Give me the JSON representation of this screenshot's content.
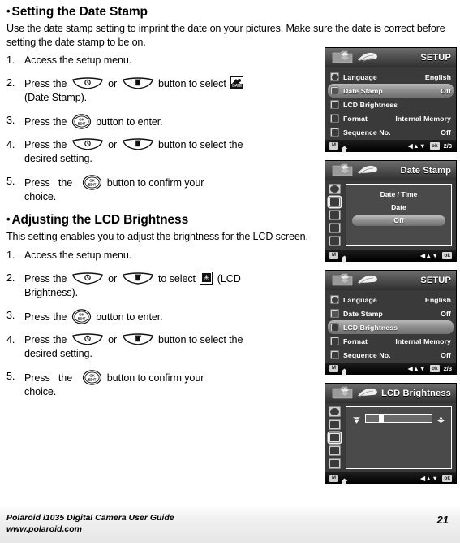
{
  "sections": [
    {
      "bullet": "•",
      "title": "Setting the Date Stamp",
      "intro": "Use the date stamp setting to imprint the date on your pictures. Make sure the date is correct before setting the date stamp to be on.",
      "steps": [
        {
          "num": "1.",
          "pre": "Access the setup menu.",
          "post": "",
          "line2": ""
        },
        {
          "num": "2.",
          "pre": "Press the",
          "mid": "or",
          "mid2": "button to select",
          "post": "",
          "line2": "(Date Stamp)."
        },
        {
          "num": "3.",
          "pre": "Press the",
          "post": "button to enter.",
          "line2": ""
        },
        {
          "num": "4.",
          "pre": "Press the",
          "mid": "or",
          "mid2": "button to select the",
          "post": "",
          "line2": "desired setting."
        },
        {
          "num": "5.",
          "pre": "Press",
          "mid": "the",
          "mid2": "button  to  confirm  your",
          "post": "",
          "line2": "choice."
        }
      ]
    },
    {
      "bullet": "•",
      "title": "Adjusting the LCD Brightness",
      "intro": "This setting enables you to adjust the brightness for the LCD screen.",
      "steps": [
        {
          "num": "1.",
          "pre": "Access the setup menu.",
          "post": "",
          "line2": ""
        },
        {
          "num": "2.",
          "pre": "Press the",
          "mid": "or",
          "mid2": "to select",
          "post": "(LCD",
          "line2": "Brightness)."
        },
        {
          "num": "3.",
          "pre": "Press the",
          "post": "button to enter.",
          "line2": ""
        },
        {
          "num": "4.",
          "pre": "Press the",
          "mid": "or",
          "mid2": "button to select the",
          "post": "",
          "line2": "desired setting."
        },
        {
          "num": "5.",
          "pre": "Press",
          "mid": "the",
          "mid2": "button  to  confirm  your",
          "post": "",
          "line2": "choice."
        }
      ]
    }
  ],
  "icon_labels": {
    "date_stamp_icon": "DATE",
    "lcd_icon_glyph": "✳",
    "ok_button_top": "OK",
    "ok_button_bottom": "EDIT"
  },
  "screens": [
    {
      "id": "setup-menu-date-stamp",
      "title": "SETUP",
      "rows": [
        {
          "label": "Language",
          "value": "English",
          "selected": false,
          "icon": "globe-icon"
        },
        {
          "label": "Date Stamp",
          "value": "Off",
          "selected": true,
          "icon": "date-stamp-icon"
        },
        {
          "label": "LCD Brightness",
          "value": "",
          "selected": false,
          "icon": "lcd-brightness-icon"
        },
        {
          "label": "Format",
          "value": "Internal Memory",
          "selected": false,
          "icon": "format-icon"
        },
        {
          "label": "Sequence No.",
          "value": "Off",
          "selected": false,
          "icon": "sequence-icon"
        }
      ],
      "footer": {
        "mode": "M",
        "arrows": "◀▲▼",
        "ok": "ok",
        "page": "2/3"
      }
    },
    {
      "id": "date-stamp-submenu",
      "title": "Date Stamp",
      "options": [
        {
          "label": "Date / Time",
          "selected": false
        },
        {
          "label": "Date",
          "selected": false
        },
        {
          "label": "Off",
          "selected": true
        }
      ],
      "sidebar_active_index": 1,
      "footer": {
        "mode": "M",
        "arrows": "◀▲▼",
        "ok": "ok",
        "page": ""
      }
    },
    {
      "id": "setup-menu-lcd-brightness",
      "title": "SETUP",
      "rows": [
        {
          "label": "Language",
          "value": "English",
          "selected": false,
          "icon": "globe-icon"
        },
        {
          "label": "Date Stamp",
          "value": "Off",
          "selected": false,
          "icon": "date-stamp-icon"
        },
        {
          "label": "LCD Brightness",
          "value": "",
          "selected": true,
          "icon": "lcd-brightness-icon"
        },
        {
          "label": "Format",
          "value": "Internal Memory",
          "selected": false,
          "icon": "format-icon"
        },
        {
          "label": "Sequence No.",
          "value": "Off",
          "selected": false,
          "icon": "sequence-icon"
        }
      ],
      "footer": {
        "mode": "M",
        "arrows": "◀▲▼",
        "ok": "ok",
        "page": "2/3"
      }
    },
    {
      "id": "lcd-brightness-slider",
      "title": "LCD Brightness",
      "slider": {
        "value_percent": 20
      },
      "sidebar_active_index": 2,
      "footer": {
        "mode": "M",
        "arrows": "◀▲▼",
        "ok": "ok",
        "page": ""
      }
    }
  ],
  "footer": {
    "guide": "Polaroid i1035 Digital Camera User Guide",
    "url": "www.polaroid.com",
    "page_number": "21"
  }
}
